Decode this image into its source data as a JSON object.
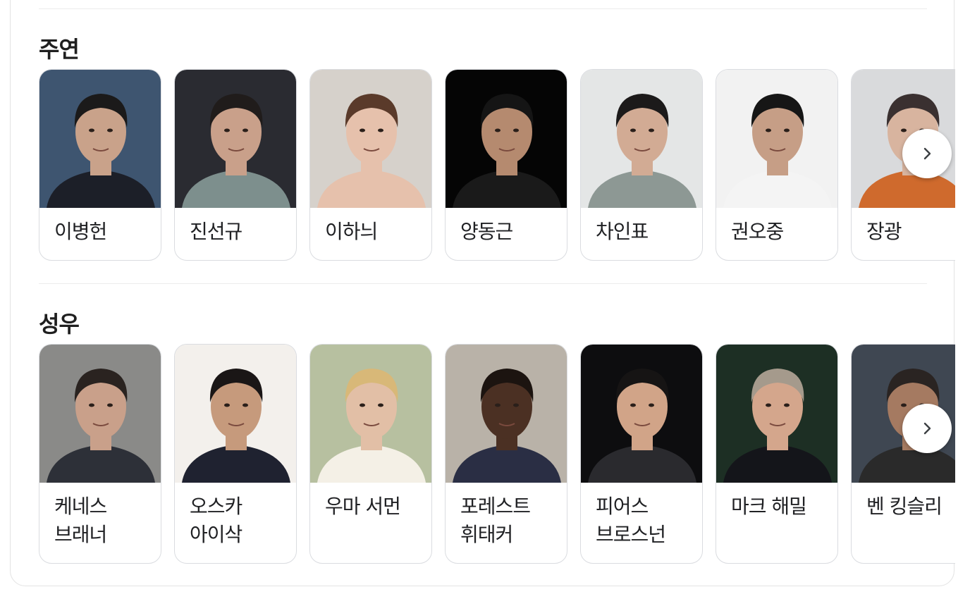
{
  "sections": [
    {
      "title": "주연",
      "cast": [
        {
          "name": "이병헌",
          "bg": "#3e5570",
          "skin": "#c9a28a",
          "hair": "#1b1a1a",
          "shirt": "#1c1f28"
        },
        {
          "name": "진선규",
          "bg": "#2a2b31",
          "skin": "#c9a08a",
          "hair": "#201c1b",
          "shirt": "#7d8f8d"
        },
        {
          "name": "이하늬",
          "bg": "#d6d1cb",
          "skin": "#e6c1ac",
          "hair": "#5a3a2a",
          "shirt": "#e6c1ac"
        },
        {
          "name": "양동근",
          "bg": "#050505",
          "skin": "#b58a6f",
          "hair": "#151515",
          "shirt": "#1a1a1a"
        },
        {
          "name": "차인표",
          "bg": "#e4e6e6",
          "skin": "#d2ab94",
          "hair": "#1c1a1a",
          "shirt": "#8d9894"
        },
        {
          "name": "권오중",
          "bg": "#f2f2f2",
          "skin": "#c69e86",
          "hair": "#161616",
          "shirt": "#f4f4f4"
        },
        {
          "name": "장광",
          "bg": "#d9dadc",
          "skin": "#d8b49f",
          "hair": "#3a3030",
          "shirt": "#cf6a2d"
        }
      ],
      "next_label": "›"
    },
    {
      "title": "성우",
      "cast": [
        {
          "name": "케네스 브래너",
          "bg": "#8a8a88",
          "skin": "#c9a08a",
          "hair": "#2a2320",
          "shirt": "#2d3038"
        },
        {
          "name": "오스카 아이삭",
          "bg": "#f3f0ec",
          "skin": "#c69a7c",
          "hair": "#1a1616",
          "shirt": "#1f2230"
        },
        {
          "name": "우마 서먼",
          "bg": "#b7c0a0",
          "skin": "#e2bfa6",
          "hair": "#d8b878",
          "shirt": "#f4f0e6"
        },
        {
          "name": "포레스트 휘태커",
          "bg": "#b9b2a8",
          "skin": "#4b3023",
          "hair": "#1c1410",
          "shirt": "#2a2e44"
        },
        {
          "name": "피어스 브로스넌",
          "bg": "#0d0d0f",
          "skin": "#d1a488",
          "hair": "#161414",
          "shirt": "#2a2a2e"
        },
        {
          "name": "마크 해밀",
          "bg": "#1d2f24",
          "skin": "#d4a68c",
          "hair": "#a59a8c",
          "shirt": "#14151a"
        },
        {
          "name": "벤 킹슬리",
          "bg": "#3f4752",
          "skin": "#a57a61",
          "hair": "#2a2422",
          "shirt": "#2a2a2a"
        }
      ],
      "next_label": "›"
    }
  ]
}
